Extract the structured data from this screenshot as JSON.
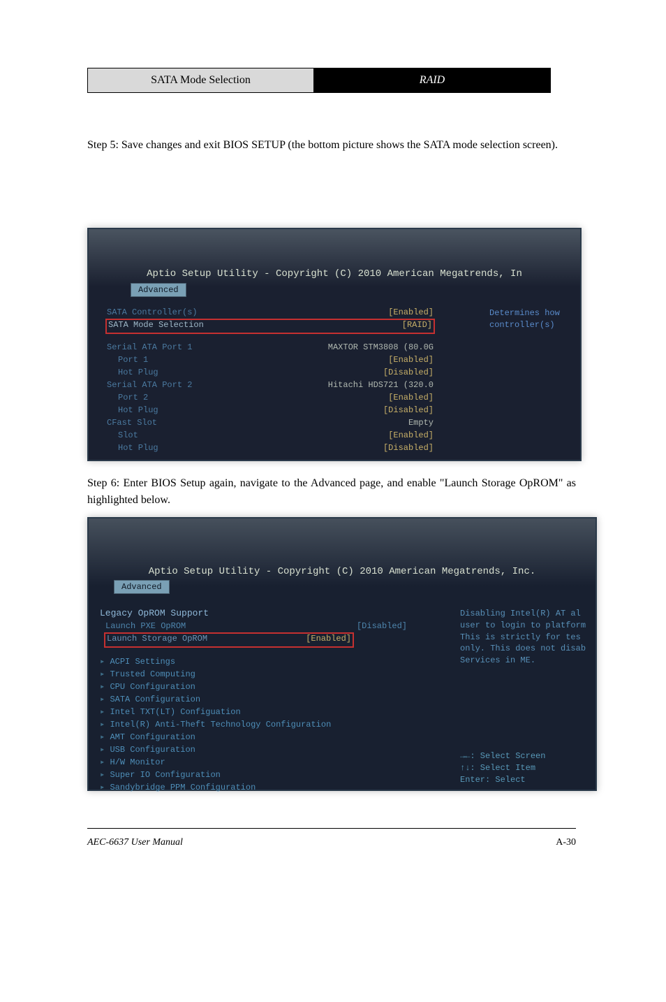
{
  "table": {
    "left": "SATA Mode Selection",
    "right": "RAID"
  },
  "text_after_table": "Step 5: Save changes and exit BIOS SETUP (the bottom picture shows the SATA mode selection screen).",
  "text_before_shot2": "Step 6: Enter BIOS Setup again, navigate to the Advanced page, and enable \"Launch Storage OpROM\" as highlighted below.",
  "bios1": {
    "title": "Aptio Setup Utility - Copyright (C) 2010 American Megatrends, In",
    "tab": "Advanced",
    "rows": {
      "controller": {
        "k": "SATA Controller(s)",
        "v": "[Enabled]"
      },
      "mode": {
        "k": "SATA Mode Selection",
        "v": "[RAID]"
      },
      "p1": {
        "k": "Serial ATA Port 1",
        "v": "MAXTOR STM3808 (80.0G"
      },
      "port1": {
        "k": "Port 1",
        "v": "[Enabled]"
      },
      "hp1": {
        "k": "Hot Plug",
        "v": "[Disabled]"
      },
      "p2": {
        "k": "Serial ATA Port 2",
        "v": "Hitachi HDS721 (320.0"
      },
      "port2": {
        "k": "Port 2",
        "v": "[Enabled]"
      },
      "hp2": {
        "k": "Hot Plug",
        "v": "[Disabled]"
      },
      "cfast": {
        "k": "CFast Slot",
        "v": "Empty"
      },
      "slot": {
        "k": "Slot",
        "v": "[Enabled]"
      },
      "hp3": {
        "k": "Hot Plug",
        "v": "[Disabled]"
      }
    },
    "help": "Determines how controller(s)"
  },
  "bios2": {
    "title": "Aptio Setup Utility - Copyright (C) 2010 American Megatrends, Inc.",
    "tab": "Advanced",
    "legacy_head": "Legacy OpROM Support",
    "pxe": {
      "k": "Launch PXE OpROM",
      "v": "[Disabled]"
    },
    "storage": {
      "k": "Launch Storage OpROM",
      "v": "[Enabled]"
    },
    "menu": [
      "ACPI Settings",
      "Trusted Computing",
      "CPU Configuration",
      "SATA Configuration",
      "Intel TXT(LT) Configuation",
      "Intel(R) Anti-Theft Technology Configuration",
      "AMT Configuration",
      "USB Configuration",
      "H/W Monitor",
      "Super IO Configuration",
      "Sandybridge PPM Configuration"
    ],
    "help_lines": [
      "Disabling Intel(R) AT al",
      "user to login to platform",
      "This is strictly for tes",
      "only. This does not disab",
      "Services in ME."
    ],
    "nav": [
      "→←: Select Screen",
      "↑↓: Select Item",
      "Enter: Select"
    ]
  },
  "footer": {
    "left": "AEC-6637 User Manual",
    "right": "A-30"
  }
}
